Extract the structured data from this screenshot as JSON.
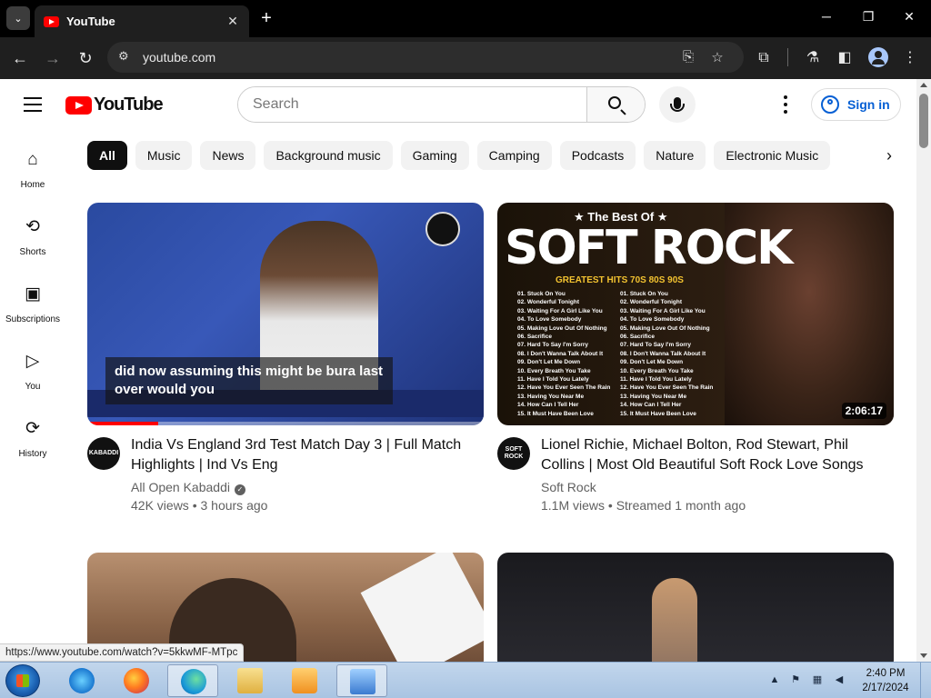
{
  "browser": {
    "tab_title": "YouTube",
    "tab_close": "✕",
    "new_tab": "+",
    "url": "youtube.com",
    "window_controls": {
      "minimize": "─",
      "restore": "❐",
      "close": "✕"
    }
  },
  "youtube": {
    "logo_text": "YouTube",
    "search_placeholder": "Search",
    "sign_in": "Sign in",
    "sidebar": [
      {
        "label": "Home",
        "icon": "⌂"
      },
      {
        "label": "Shorts",
        "icon": "⟲"
      },
      {
        "label": "Subscriptions",
        "icon": "▣"
      },
      {
        "label": "You",
        "icon": "▷"
      },
      {
        "label": "History",
        "icon": "⟳"
      }
    ],
    "chips": [
      "All",
      "Music",
      "News",
      "Background music",
      "Gaming",
      "Camping",
      "Podcasts",
      "Nature",
      "Electronic Music"
    ],
    "chip_next": "›",
    "videos": [
      {
        "title": "India Vs England 3rd Test Match Day 3 | Full Match Highlights | Ind Vs Eng",
        "channel": "All Open Kabaddi",
        "verified": "✓",
        "meta": "42K views • 3 hours ago",
        "caption": "did now assuming this might be bura last over would you",
        "avatar_text": "KABADDI",
        "watched_progress": 0.18
      },
      {
        "title": "Lionel Richie, Michael Bolton, Rod Stewart, Phil Collins | Most Old Beautiful Soft Rock Love Songs",
        "channel": "Soft Rock",
        "meta": "1.1M views • Streamed 1 month ago",
        "duration": "2:06:17",
        "avatar_text": "SOFT ROCK",
        "thumb_top": "★ The Best Of ★",
        "thumb_title": "SOFT ROCK",
        "thumb_sub": "GREATEST HITS 70S 80S 90S",
        "tracklist": [
          "01. Stuck On You",
          "02. Wonderful Tonight",
          "03. Waiting For A Girl Like You",
          "04. To Love Somebody",
          "05. Making Love Out Of Nothing",
          "06. Sacrifice",
          "07. Hard To Say I'm Sorry",
          "08. I Don't Wanna Talk About It",
          "09. Don't Let Me Down",
          "10. Every Breath You Take",
          "11. Have I Told You Lately",
          "12. Have You Ever Seen The Rain",
          "13. Having You Near Me",
          "14. How Can I Tell Her",
          "15. It Must Have Been Love"
        ]
      }
    ]
  },
  "status_url": "https://www.youtube.com/watch?v=5kkwMF-MTpc",
  "taskbar": {
    "time": "2:40 PM",
    "date": "2/17/2024"
  }
}
